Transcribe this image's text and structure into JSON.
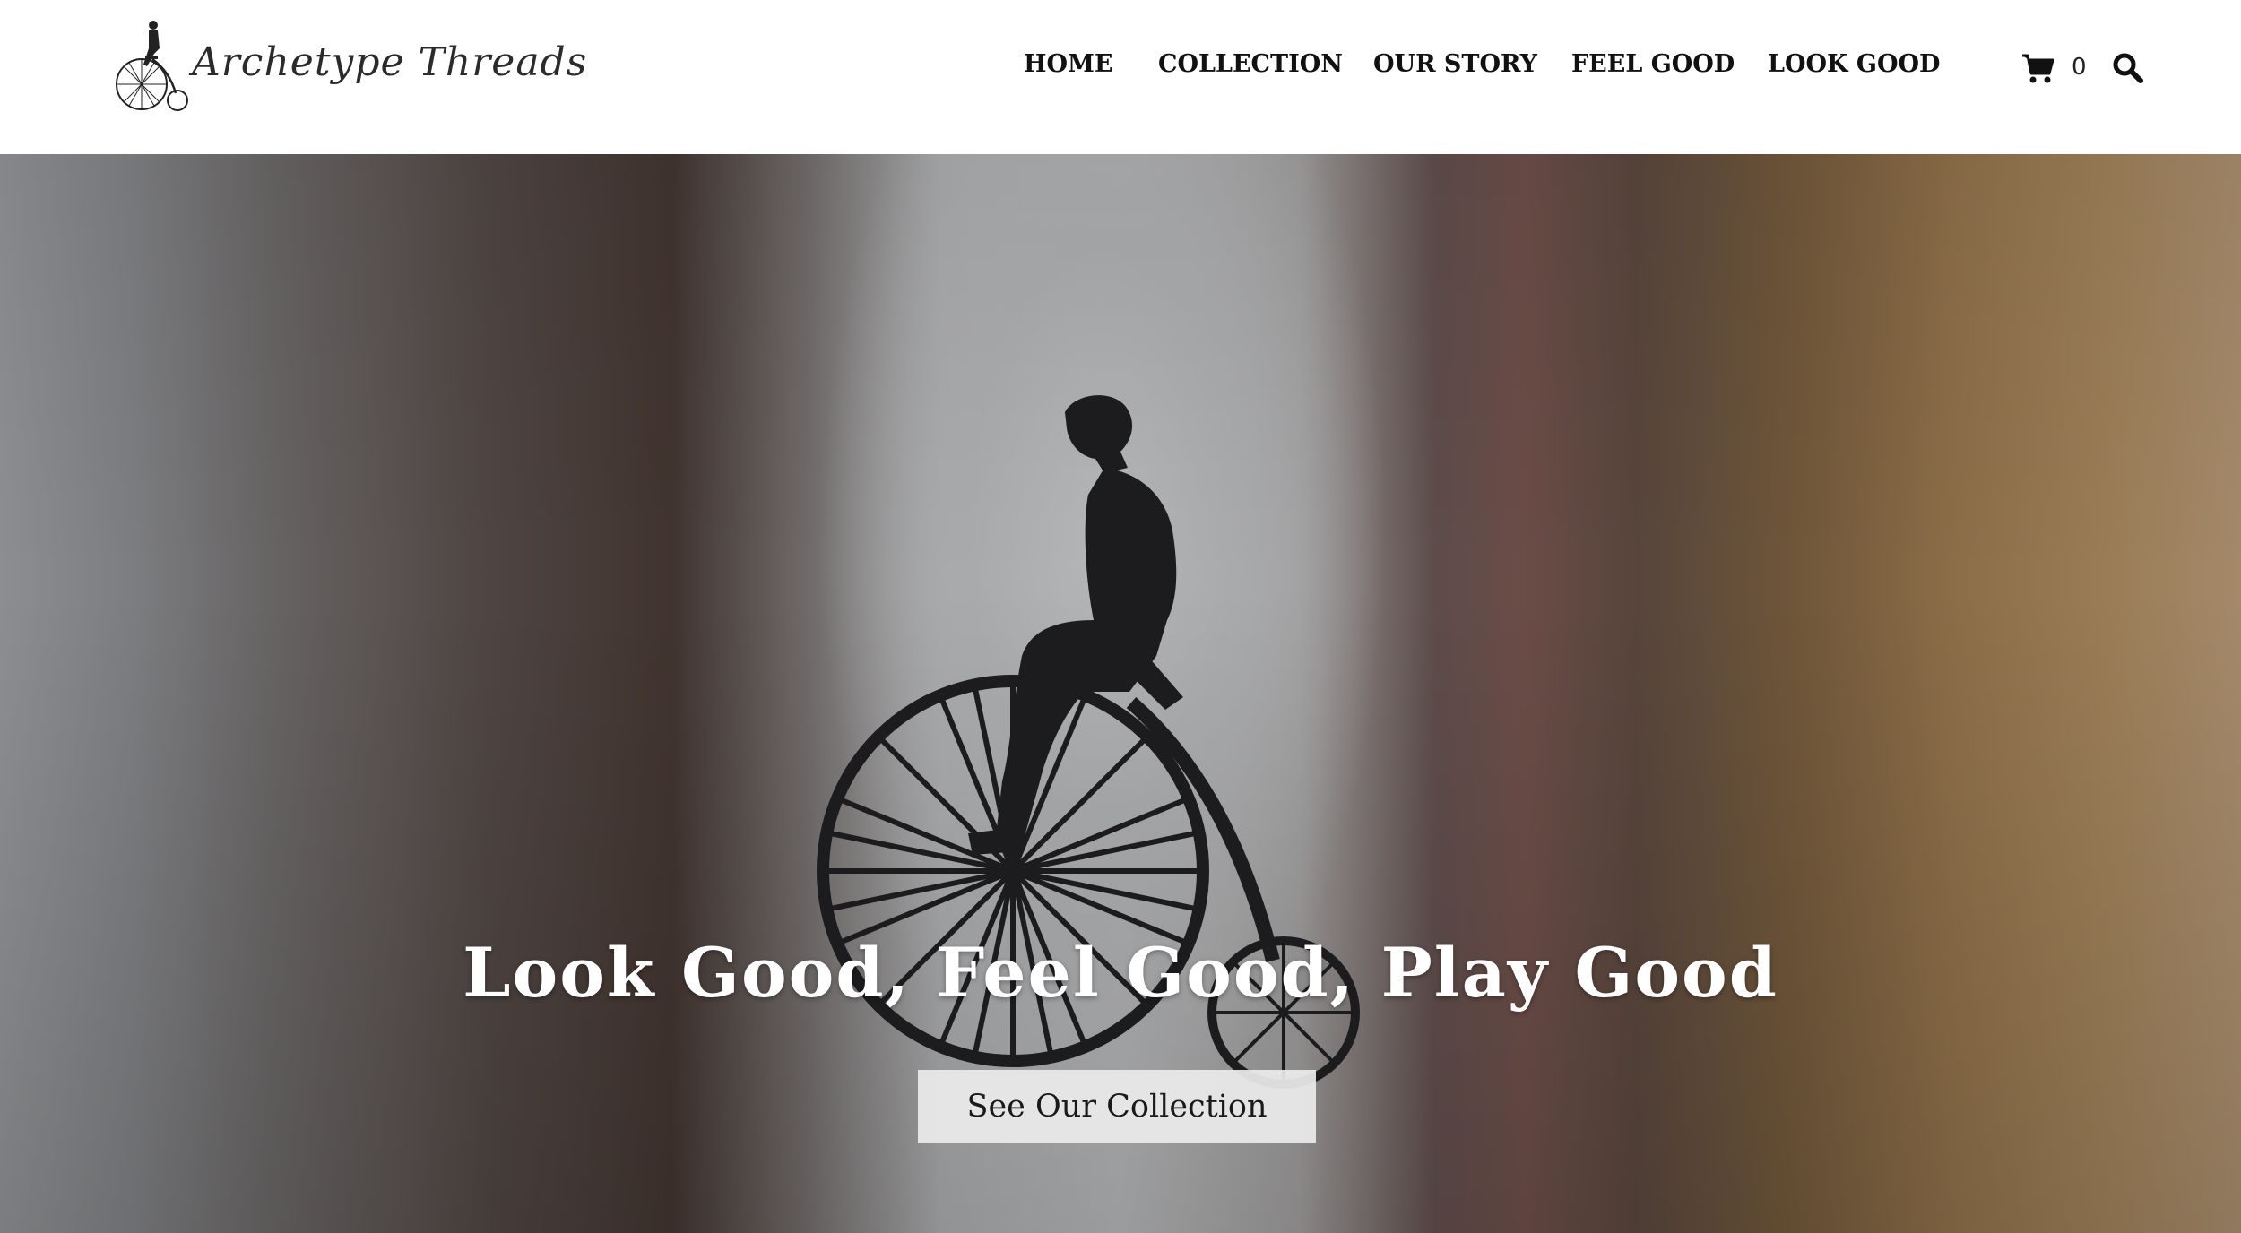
{
  "brand": {
    "name": "Archetype Threads",
    "logo_icon": "penny-farthing-rider-icon"
  },
  "nav": {
    "items": [
      {
        "label": "HOME"
      },
      {
        "label": "COLLECTION"
      },
      {
        "label": "OUR STORY"
      },
      {
        "label": "FEEL GOOD"
      },
      {
        "label": "LOOK GOOD"
      }
    ]
  },
  "cart": {
    "icon": "cart-icon",
    "count": "0"
  },
  "search": {
    "icon": "search-icon"
  },
  "hero": {
    "image": "penny-farthing-silhouette",
    "title": "Look Good, Feel Good, Play Good",
    "button_label": "See Our Collection"
  },
  "colors": {
    "nav_text": "#111111",
    "hero_text": "#ffffff",
    "button_bg": "#ebebeb",
    "silhouette": "#1c1c1e"
  }
}
